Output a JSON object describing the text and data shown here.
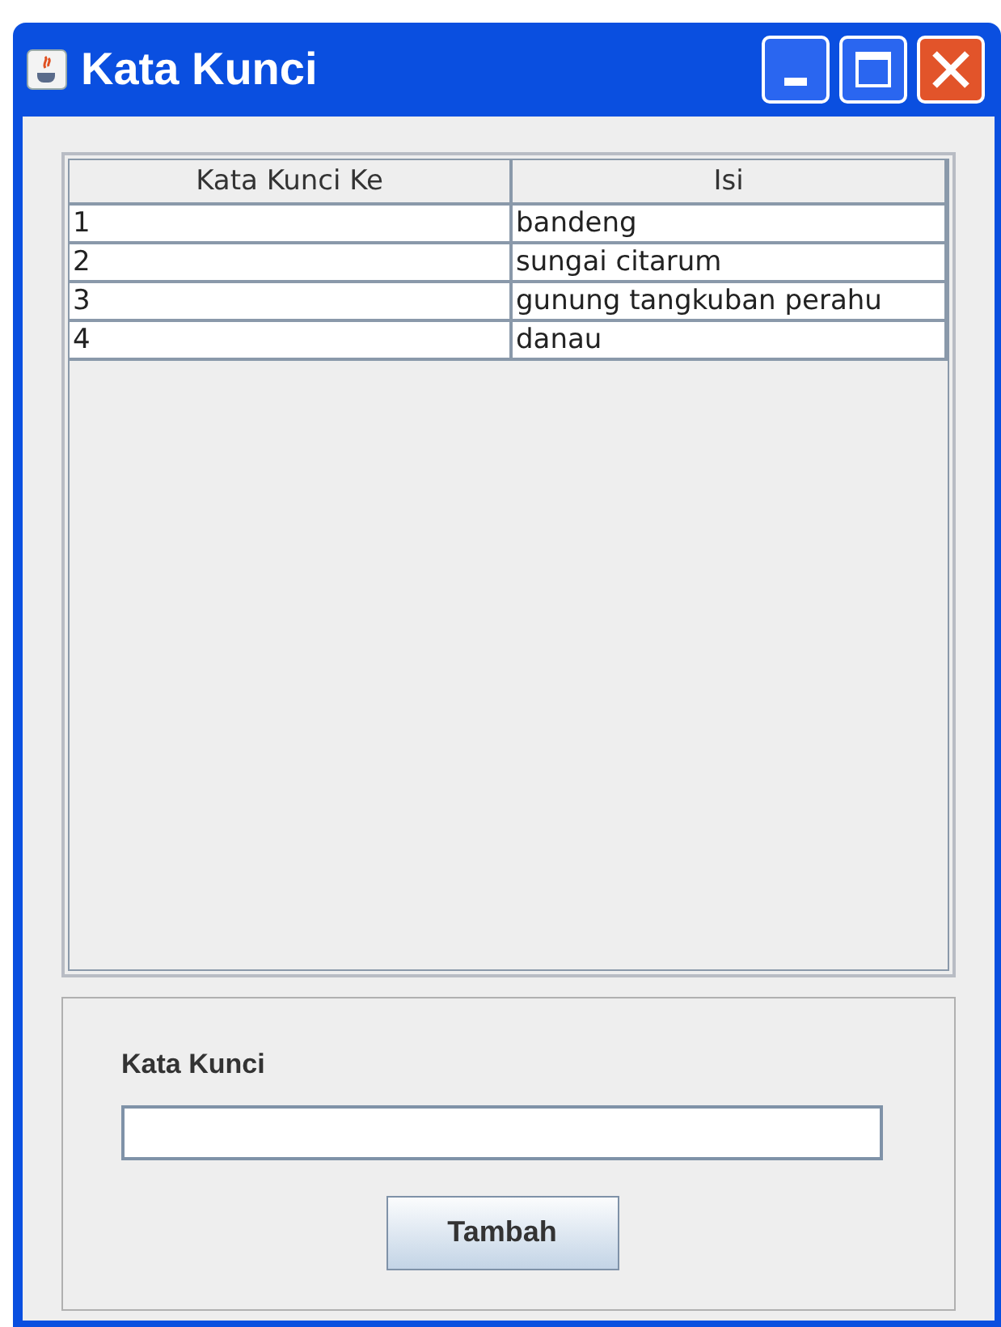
{
  "window": {
    "title": "Kata Kunci"
  },
  "table": {
    "columns": [
      "Kata Kunci Ke",
      "Isi"
    ],
    "rows": [
      [
        "1",
        "bandeng"
      ],
      [
        "2",
        "sungai citarum"
      ],
      [
        "3",
        "gunung tangkuban perahu"
      ],
      [
        "4",
        "danau"
      ]
    ]
  },
  "form": {
    "label": "Kata Kunci",
    "button": "Tambah"
  }
}
